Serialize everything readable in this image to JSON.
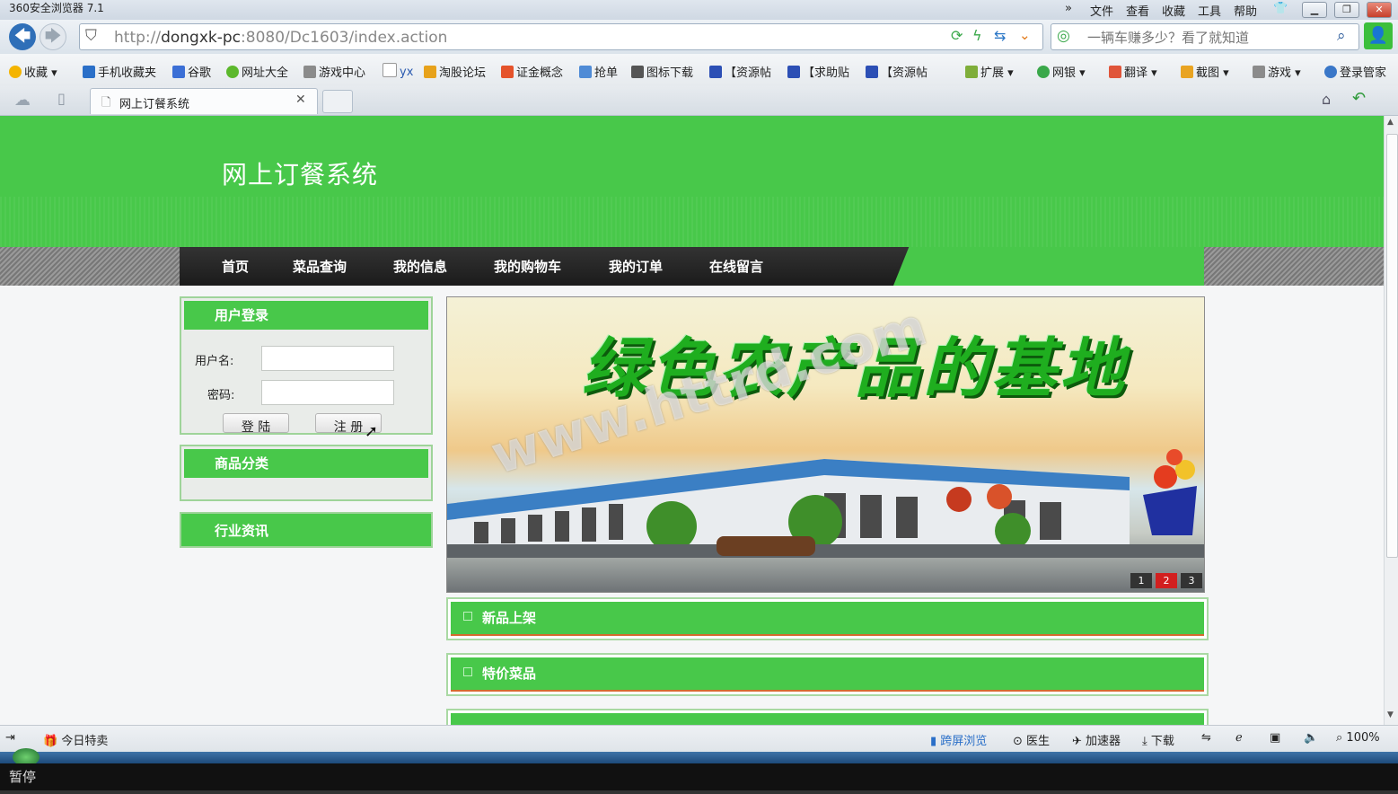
{
  "browser": {
    "title": "360安全浏览器 7.1",
    "menu": [
      "文件",
      "查看",
      "收藏",
      "工具",
      "帮助"
    ],
    "url_prefix": "http://",
    "url_host": "dongxk-pc",
    "url_rest": ":8080/Dc1603/index.action",
    "search_placeholder": "一辆车赚多少？看了就知道",
    "favorites": [
      "收藏",
      "手机收藏夹",
      "谷歌",
      "网址大全",
      "游戏中心",
      "yx",
      "淘股论坛",
      "证金概念",
      "抢单",
      "图标下载",
      "【资源帖",
      "【求助贴",
      "【资源帖"
    ],
    "right_tools": [
      "扩展",
      "网银",
      "翻译",
      "截图",
      "游戏",
      "登录管家"
    ],
    "tab_title": "网上订餐系统",
    "status_left": "今日特卖",
    "status_right": [
      "跨屏浏览",
      "医生",
      "加速器",
      "下载"
    ],
    "zoom": "100%",
    "player_status": "暂停"
  },
  "site": {
    "title": "网上订餐系统",
    "nav": [
      "首页",
      "菜品查询",
      "我的信息",
      "我的购物车",
      "我的订单",
      "在线留言"
    ],
    "login": {
      "heading": "用户登录",
      "username_label": "用户名:",
      "password_label": "密码:",
      "login_button": "登 陆",
      "register_button": "注 册"
    },
    "category_heading": "商品分类",
    "news_heading": "行业资讯",
    "banner": {
      "headline": "绿色农产品的基地",
      "watermark": "www.httrd.com",
      "pages": [
        "1",
        "2",
        "3"
      ],
      "active_page": "2"
    },
    "sections": [
      "新品上架",
      "特价菜品"
    ]
  },
  "colors": {
    "brand_green": "#48c84a",
    "nav_dark": "#1b1b1b",
    "active_page": "#d21f1f"
  }
}
